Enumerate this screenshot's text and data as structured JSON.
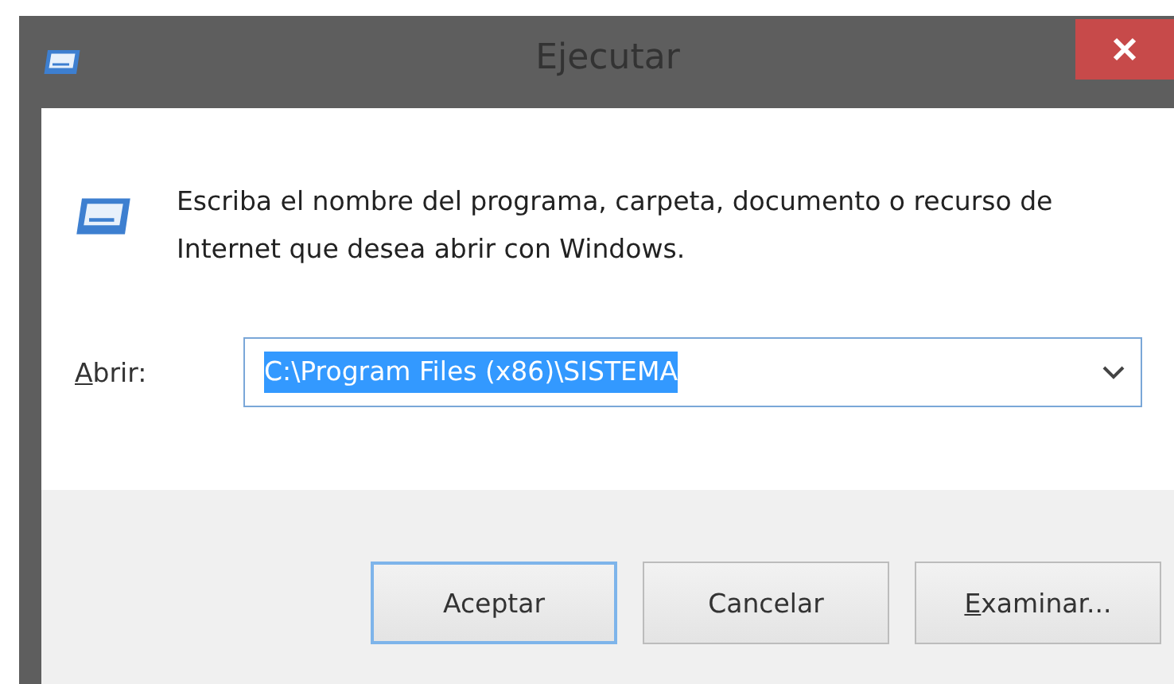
{
  "window": {
    "title": "Ejecutar"
  },
  "prompt": "Escriba el nombre del programa, carpeta, documento o recurso de Internet que desea abrir con Windows.",
  "open_field": {
    "label": "Abrir:",
    "value": "C:\\Program Files (x86)\\SISTEMA",
    "value_selected": true
  },
  "buttons": [
    {
      "label": "Aceptar",
      "default": true
    },
    {
      "label": "Cancelar",
      "default": false
    },
    {
      "label": "Examinar...",
      "default": false
    }
  ]
}
